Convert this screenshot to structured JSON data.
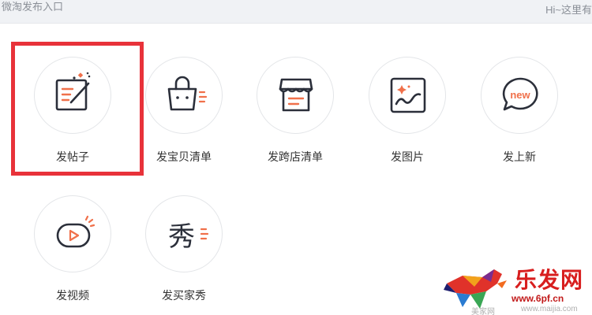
{
  "header": {
    "title": "微淘发布入口",
    "greeting": "Hi~这里有"
  },
  "entries": [
    {
      "label": "发帖子",
      "icon": "edit-post-icon"
    },
    {
      "label": "发宝贝清单",
      "icon": "shopping-bag-icon"
    },
    {
      "label": "发跨店清单",
      "icon": "store-icon"
    },
    {
      "label": "发图片",
      "icon": "image-icon"
    },
    {
      "label": "发上新",
      "icon": "new-bubble-icon",
      "icon_text": "new"
    },
    {
      "label": "发视频",
      "icon": "video-icon"
    },
    {
      "label": "发买家秀",
      "icon": "buyer-show-icon",
      "icon_text": "秀"
    }
  ],
  "watermark": {
    "brand": "乐发网",
    "url": "www.6pf.cn",
    "small_left": "美家网",
    "small_right": "www.maijia.com"
  },
  "colors": {
    "accent": "#f0704a",
    "icon_stroke": "#2b2f3a",
    "highlight": "#e8323a",
    "header_bg": "#f0f2f5"
  }
}
